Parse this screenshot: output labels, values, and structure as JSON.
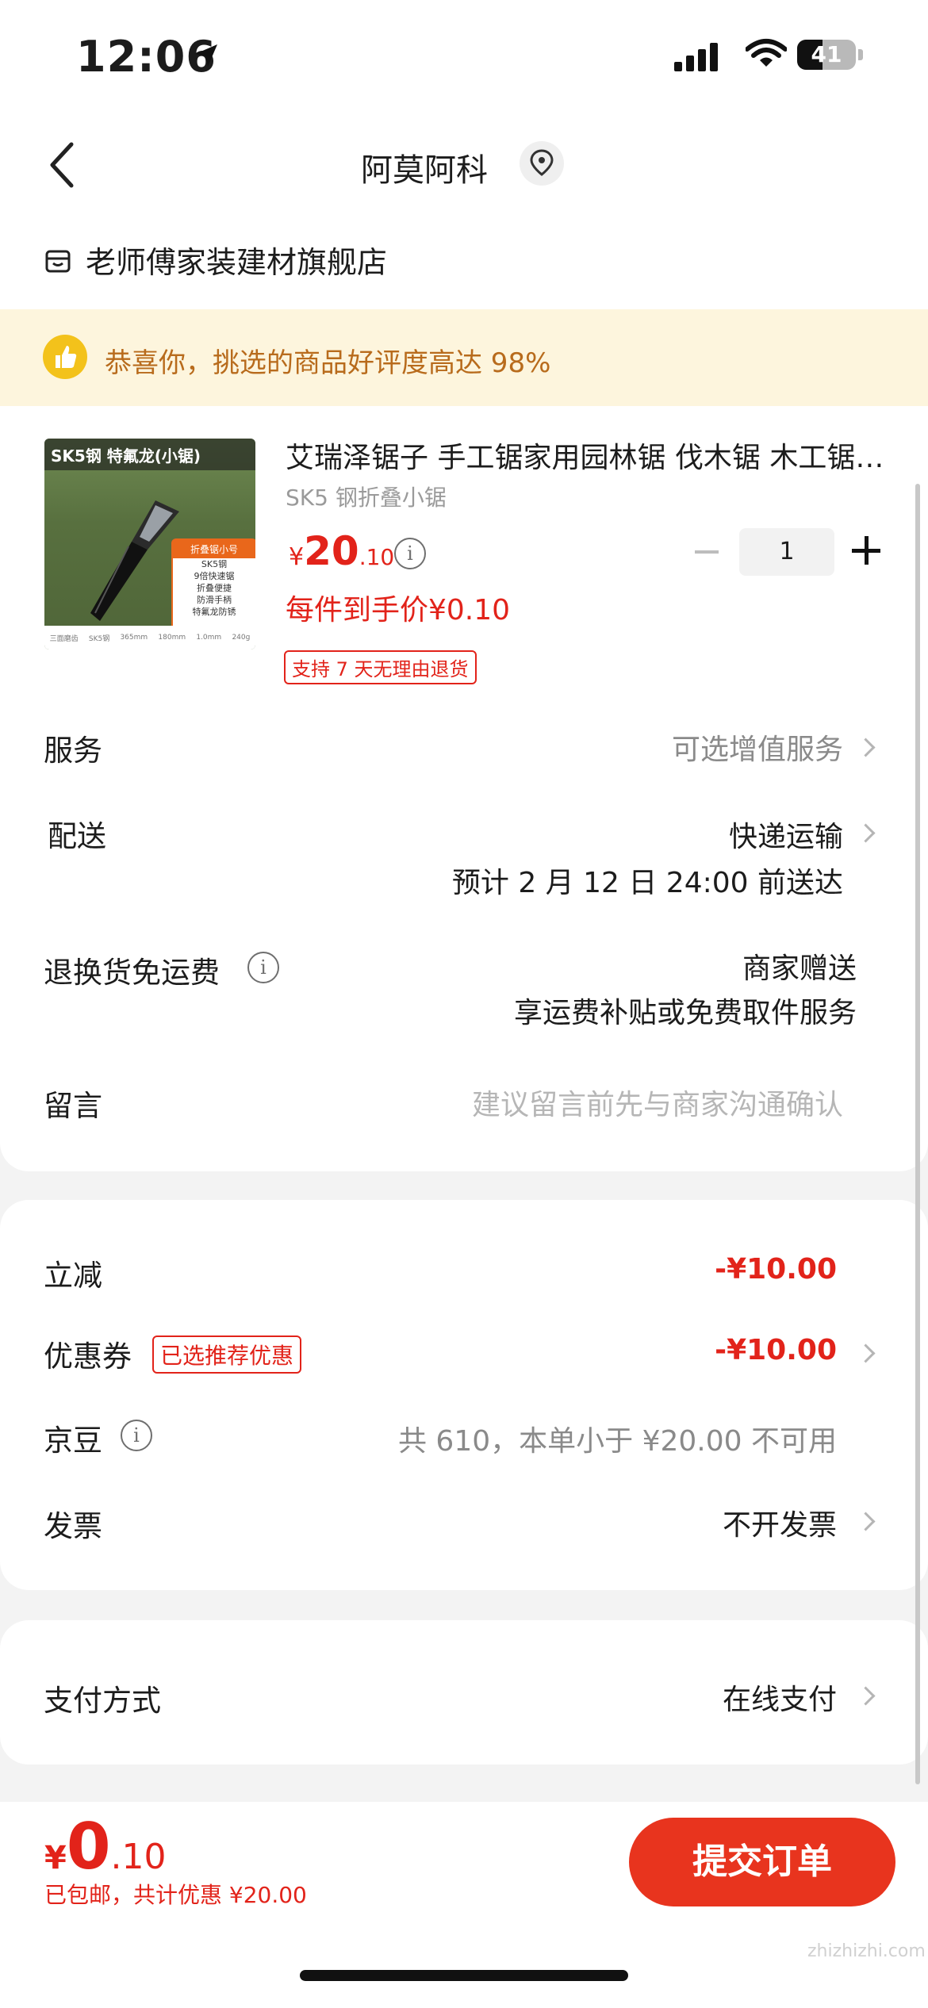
{
  "status_bar": {
    "time": "12:06",
    "battery": "41"
  },
  "header": {
    "title": "阿莫阿科"
  },
  "store": {
    "name": "老师傅家装建材旗舰店"
  },
  "banner": {
    "text": "恭喜你，挑选的商品好评度高达 98%"
  },
  "product": {
    "image_label": "SK5钢 特氟龙(小锯)",
    "image_box_title": "折叠锯小号",
    "image_box_lines": [
      "SK5钢",
      "9倍快速锯",
      "折叠便捷",
      "防滑手柄",
      "特氟龙防锈"
    ],
    "image_footer": [
      "三面磨齿",
      "SK5钢",
      "365mm",
      "180mm",
      "1.0mm",
      "240g"
    ],
    "title": "艾瑞泽锯子 手工锯家用园林锯 伐木锯 木工锯 手锯",
    "spec": "SK5 钢折叠小锯",
    "price_currency": "¥",
    "price_int": "20",
    "price_dec": ".10",
    "per_price": "每件到手价¥0.10",
    "return_tag": "支持 7 天无理由退货",
    "quantity": "1"
  },
  "rows": {
    "service_label": "服务",
    "service_value": "可选增值服务",
    "delivery_label": "配送",
    "delivery_value": "快递运输",
    "delivery_eta": "预计 2 月 12 日 24:00 前送达",
    "return_label": "退换货免运费",
    "return_value": "商家赠送",
    "return_desc": "享运费补贴或免费取件服务",
    "message_label": "留言",
    "message_placeholder": "建议留言前先与商家沟通确认"
  },
  "discounts": {
    "instant_label": "立减",
    "instant_value": "-¥10.00",
    "coupon_label": "优惠券",
    "coupon_tag": "已选推荐优惠",
    "coupon_value": "-¥10.00",
    "jingdou_label": "京豆",
    "jingdou_value": "共 610，本单小于 ¥20.00 不可用",
    "invoice_label": "发票",
    "invoice_value": "不开发票"
  },
  "payment": {
    "label": "支付方式",
    "value": "在线支付"
  },
  "bottom": {
    "currency": "¥",
    "total_int": "0",
    "total_dec": ".10",
    "subtitle": "已包邮，共计优惠 ¥20.00",
    "submit": "提交订单"
  },
  "watermark": "zhizhizhi.com"
}
